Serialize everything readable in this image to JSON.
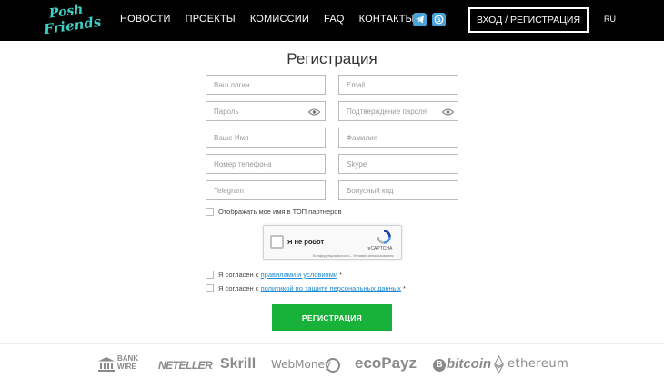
{
  "header": {
    "logo_line1": "Posh",
    "logo_line2": "Friends",
    "nav": [
      "НОВОСТИ",
      "ПРОЕКТЫ",
      "КОМИССИИ",
      "FAQ",
      "КОНТАКТЫ"
    ],
    "social_icons": [
      "telegram-icon",
      "skype-icon"
    ],
    "login_label": "ВХОД / РЕГИСТРАЦИЯ",
    "lang": "RU"
  },
  "form": {
    "title": "Регистрация",
    "placeholders": {
      "login": "Ваш логин",
      "email": "Email",
      "password": "Пароль",
      "password_confirm": "Подтверждение пароля",
      "first_name": "Ваше Имя",
      "last_name": "Фамилия",
      "phone": "Номер телефона",
      "skype": "Skype",
      "telegram": "Telegram",
      "bonus": "Бонусный код"
    },
    "show_top_label": "Отображать мое имя в ТОП партнеров",
    "captcha": {
      "label": "Я не робот",
      "brand": "reCAPTCHA",
      "links": "Конфиденциальность - Условия использования"
    },
    "agree_rules_prefix": "Я согласен с ",
    "agree_rules_link": "правилами и условиями",
    "agree_rules_suffix": " *",
    "agree_privacy_prefix": "Я согласен с ",
    "agree_privacy_link": "политикой по защите персональных данных",
    "agree_privacy_suffix": " *",
    "submit_label": "РЕГИСТРАЦИЯ"
  },
  "footer": {
    "payments": {
      "bank_line1": "BANK",
      "bank_line2": "WIRE",
      "neteller": "NETELLER",
      "skrill": "Skrill",
      "webmoney": "WebMoney",
      "ecopayz": "ecoPayz",
      "bitcoin": "bitcoin",
      "bitcoin_symbol": "B",
      "ethereum": "ethereum"
    }
  },
  "colors": {
    "header_bg": "#000000",
    "logo": "#3ed0c5",
    "submit": "#18b23b",
    "link": "#1f8ad3",
    "social": "#4aa3d8"
  }
}
